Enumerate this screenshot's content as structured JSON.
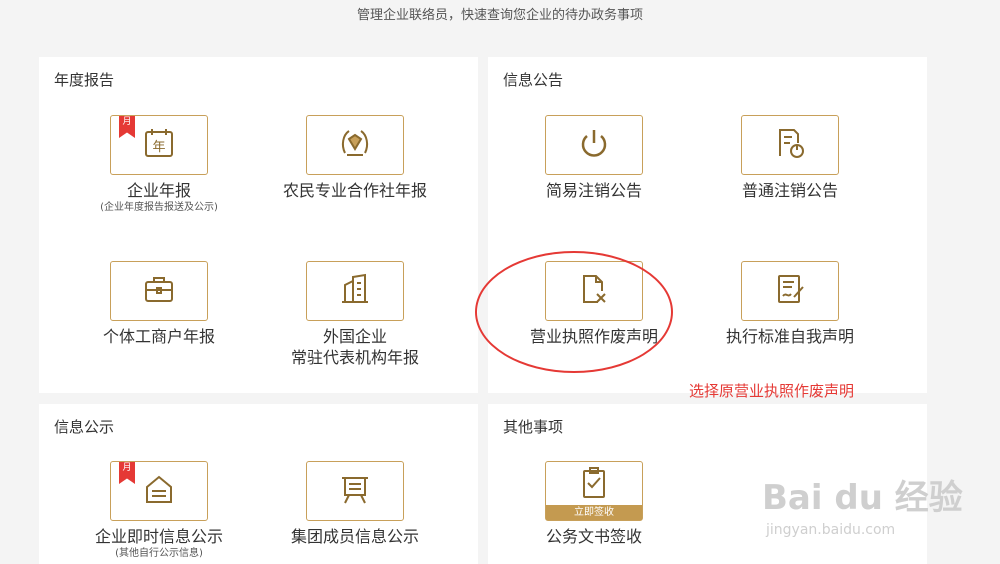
{
  "header": {
    "subtitle": "管理企业联络员，快速查询您企业的待办政务事项"
  },
  "sections": {
    "annual": {
      "title": "年度报告",
      "items": [
        {
          "label": "企业年报",
          "sub": "(企业年度报告报送及公示)",
          "icon": "calendar-year-icon",
          "ribbon": "月"
        },
        {
          "label": "农民专业合作社年报",
          "icon": "wheat-emblem-icon"
        },
        {
          "label": "个体工商户年报",
          "icon": "briefcase-icon"
        },
        {
          "label": "外国企业",
          "label2": "常驻代表机构年报",
          "icon": "building-icon"
        }
      ]
    },
    "notice": {
      "title": "信息公告",
      "items": [
        {
          "label": "简易注销公告",
          "icon": "power-icon"
        },
        {
          "label": "普通注销公告",
          "icon": "document-power-icon"
        },
        {
          "label": "营业执照作废声明",
          "icon": "document-cancel-icon"
        },
        {
          "label": "执行标准自我声明",
          "icon": "document-sign-icon"
        }
      ]
    },
    "disclosure": {
      "title": "信息公示",
      "items": [
        {
          "label": "企业即时信息公示",
          "sub": "(其他自行公示信息)",
          "icon": "bulletin-icon",
          "ribbon": "月"
        },
        {
          "label": "集团成员信息公示",
          "icon": "easel-board-icon"
        }
      ]
    },
    "other": {
      "title": "其他事项",
      "items": [
        {
          "label": "公务文书签收",
          "icon": "clipboard-check-icon",
          "badge": "立即签收"
        }
      ]
    }
  },
  "annotation": {
    "text": "选择原营业执照作废声明"
  },
  "watermark": {
    "logo": "Bai du 经验",
    "url": "jingyan.baidu.com"
  },
  "colors": {
    "accent": "#c8a05a",
    "annotation": "#e53935",
    "ribbon": "#e53935"
  }
}
